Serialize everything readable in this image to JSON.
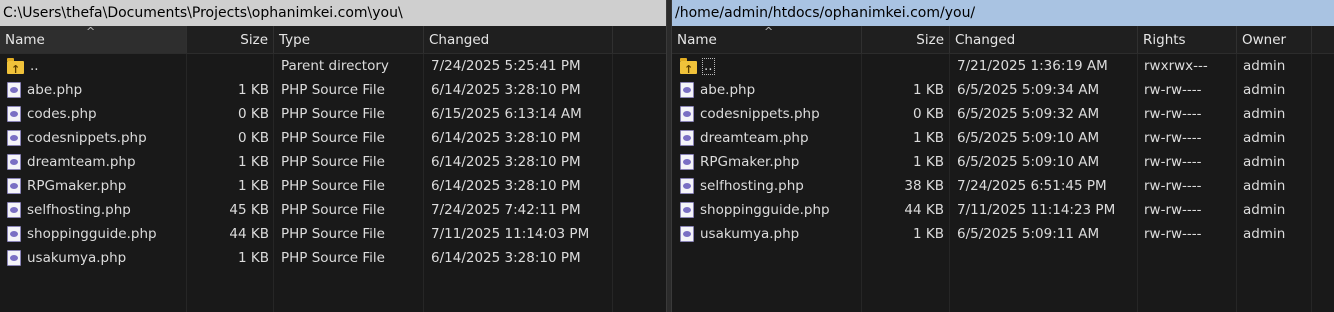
{
  "left": {
    "path": "C:\\Users\\thefa\\Documents\\Projects\\ophanimkei.com\\you\\",
    "columns": {
      "name": "Name",
      "size": "Size",
      "type": "Type",
      "changed": "Changed"
    },
    "rows": [
      {
        "name": "..",
        "size": "",
        "type": "Parent directory",
        "changed": "7/24/2025 5:25:41 PM",
        "icon": "parent-folder-icon"
      },
      {
        "name": "abe.php",
        "size": "1 KB",
        "type": "PHP Source File",
        "changed": "6/14/2025 3:28:10 PM",
        "icon": "php-file-icon"
      },
      {
        "name": "codes.php",
        "size": "0 KB",
        "type": "PHP Source File",
        "changed": "6/15/2025 6:13:14 AM",
        "icon": "php-file-icon"
      },
      {
        "name": "codesnippets.php",
        "size": "0 KB",
        "type": "PHP Source File",
        "changed": "6/14/2025 3:28:10 PM",
        "icon": "php-file-icon"
      },
      {
        "name": "dreamteam.php",
        "size": "1 KB",
        "type": "PHP Source File",
        "changed": "6/14/2025 3:28:10 PM",
        "icon": "php-file-icon"
      },
      {
        "name": "RPGmaker.php",
        "size": "1 KB",
        "type": "PHP Source File",
        "changed": "6/14/2025 3:28:10 PM",
        "icon": "php-file-icon"
      },
      {
        "name": "selfhosting.php",
        "size": "45 KB",
        "type": "PHP Source File",
        "changed": "7/24/2025 7:42:11 PM",
        "icon": "php-file-icon"
      },
      {
        "name": "shoppingguide.php",
        "size": "44 KB",
        "type": "PHP Source File",
        "changed": "7/11/2025 11:14:03 PM",
        "icon": "php-file-icon"
      },
      {
        "name": "usakumya.php",
        "size": "1 KB",
        "type": "PHP Source File",
        "changed": "6/14/2025 3:28:10 PM",
        "icon": "php-file-icon"
      }
    ]
  },
  "right": {
    "path": "/home/admin/htdocs/ophanimkei.com/you/",
    "columns": {
      "name": "Name",
      "size": "Size",
      "changed": "Changed",
      "rights": "Rights",
      "owner": "Owner"
    },
    "rows": [
      {
        "name": "..",
        "size": "",
        "changed": "7/21/2025 1:36:19 AM",
        "rights": "rwxrwx---",
        "owner": "admin",
        "icon": "parent-folder-icon"
      },
      {
        "name": "abe.php",
        "size": "1 KB",
        "changed": "6/5/2025 5:09:34 AM",
        "rights": "rw-rw----",
        "owner": "admin",
        "icon": "php-file-icon"
      },
      {
        "name": "codesnippets.php",
        "size": "0 KB",
        "changed": "6/5/2025 5:09:32 AM",
        "rights": "rw-rw----",
        "owner": "admin",
        "icon": "php-file-icon"
      },
      {
        "name": "dreamteam.php",
        "size": "1 KB",
        "changed": "6/5/2025 5:09:10 AM",
        "rights": "rw-rw----",
        "owner": "admin",
        "icon": "php-file-icon"
      },
      {
        "name": "RPGmaker.php",
        "size": "1 KB",
        "changed": "6/5/2025 5:09:10 AM",
        "rights": "rw-rw----",
        "owner": "admin",
        "icon": "php-file-icon"
      },
      {
        "name": "selfhosting.php",
        "size": "38 KB",
        "changed": "7/24/2025 6:51:45 PM",
        "rights": "rw-rw----",
        "owner": "admin",
        "icon": "php-file-icon"
      },
      {
        "name": "shoppingguide.php",
        "size": "44 KB",
        "changed": "7/11/2025 11:14:23 PM",
        "rights": "rw-rw----",
        "owner": "admin",
        "icon": "php-file-icon"
      },
      {
        "name": "usakumya.php",
        "size": "1 KB",
        "changed": "6/5/2025 5:09:11 AM",
        "rights": "rw-rw----",
        "owner": "admin",
        "icon": "php-file-icon"
      }
    ]
  },
  "colors": {
    "background": "#191919",
    "local_path_bar": "#cfcfcf",
    "remote_path_bar": "#a9c3e2",
    "text": "#dcdcdc"
  }
}
